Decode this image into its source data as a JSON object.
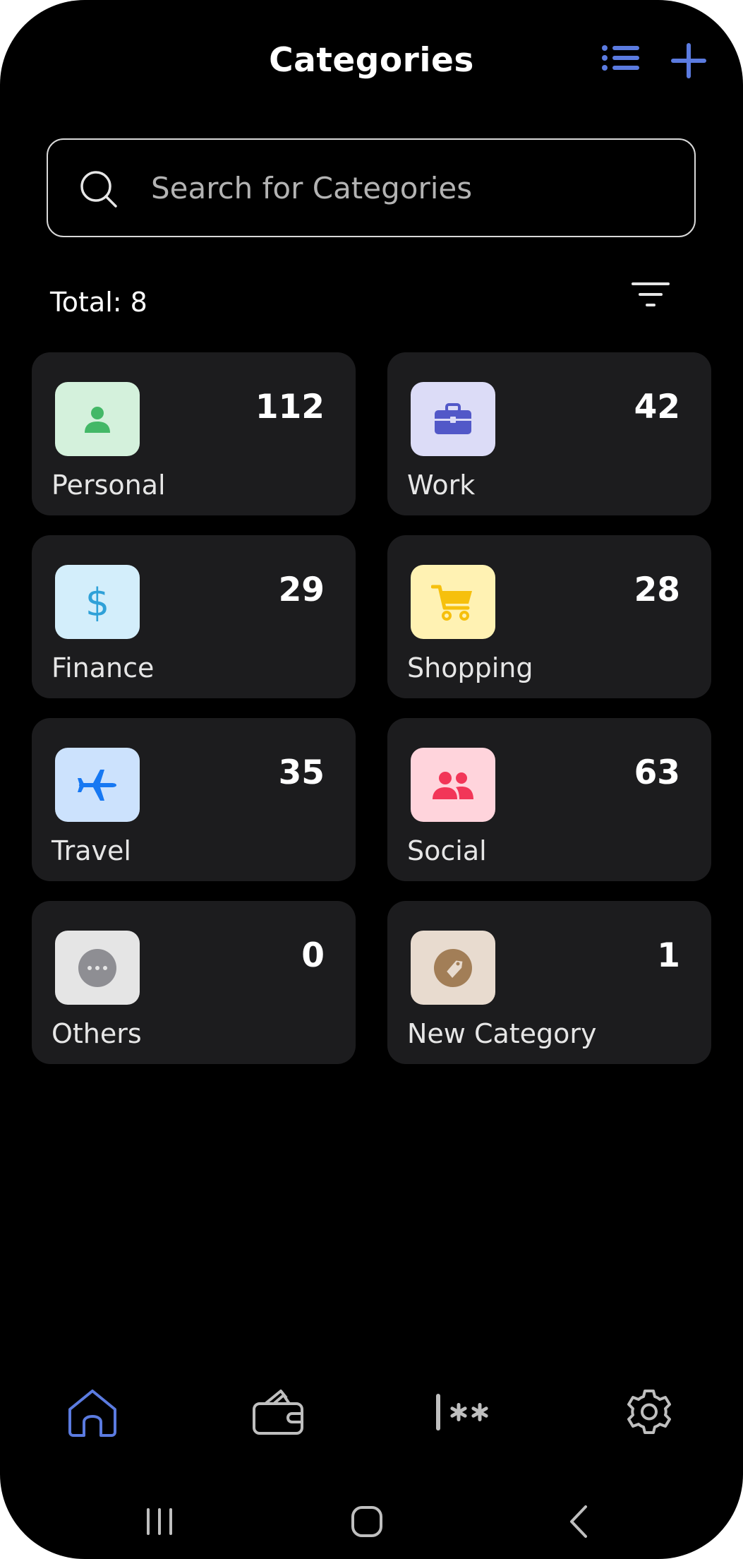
{
  "header": {
    "title": "Categories"
  },
  "search": {
    "placeholder": "Search for Categories"
  },
  "summary": {
    "total_text": "Total: 8"
  },
  "categories": [
    {
      "label": "Personal",
      "count": "112",
      "icon": "person-icon",
      "bg": "#d4f1dc",
      "fg": "#43b867"
    },
    {
      "label": "Work",
      "count": "42",
      "icon": "briefcase-icon",
      "bg": "#dcdcf7",
      "fg": "#5258c8"
    },
    {
      "label": "Finance",
      "count": "29",
      "icon": "dollar-icon",
      "bg": "#d3eefb",
      "fg": "#2fa1d8"
    },
    {
      "label": "Shopping",
      "count": "28",
      "icon": "cart-icon",
      "bg": "#fff2b3",
      "fg": "#f6c00d"
    },
    {
      "label": "Travel",
      "count": "35",
      "icon": "airplane-icon",
      "bg": "#cce2fd",
      "fg": "#1778f2"
    },
    {
      "label": "Social",
      "count": "63",
      "icon": "people-icon",
      "bg": "#ffd4dc",
      "fg": "#f23658"
    },
    {
      "label": "Others",
      "count": "0",
      "icon": "more-icon",
      "bg": "#e5e5e5",
      "fg": "#8e8e93"
    },
    {
      "label": "New Category",
      "count": "1",
      "icon": "tag-icon",
      "bg": "#e8dbcf",
      "fg": "#a27e57"
    }
  ],
  "colors": {
    "accent": "#5b7be0",
    "background": "#000000",
    "card": "#1c1c1e"
  },
  "bottom_nav": [
    {
      "name": "home-icon",
      "active": true
    },
    {
      "name": "wallet-icon",
      "active": false
    },
    {
      "name": "password-icon",
      "active": false
    },
    {
      "name": "settings-icon",
      "active": false
    }
  ],
  "system_nav": [
    "recent-apps-icon",
    "home-circle-icon",
    "back-icon"
  ]
}
